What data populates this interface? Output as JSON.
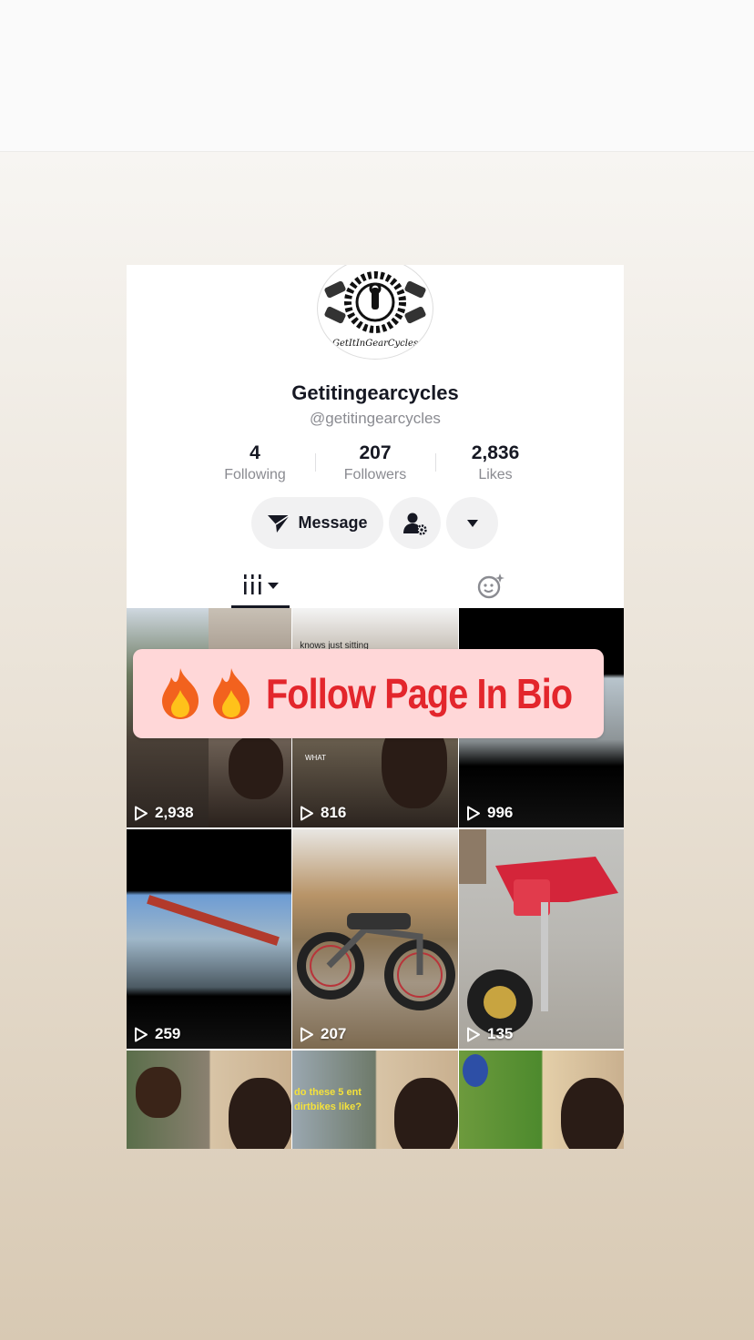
{
  "profile": {
    "display_name": "Getitingearcycles",
    "handle": "@getitingearcycles",
    "avatar_text": "GetItInGearCycles"
  },
  "stats": [
    {
      "value": "4",
      "label": "Following"
    },
    {
      "value": "207",
      "label": "Followers"
    },
    {
      "value": "2,836",
      "label": "Likes"
    }
  ],
  "actions": {
    "message_label": "Message",
    "add_friend_icon": "person-gear-icon",
    "more_icon": "caret-down-icon"
  },
  "tabs": [
    {
      "name": "videos",
      "icon": "grid-bars-icon",
      "active": true
    },
    {
      "name": "liked",
      "icon": "sparkle-face-icon",
      "active": false
    }
  ],
  "videos": [
    {
      "views": "2,938"
    },
    {
      "views": "816"
    },
    {
      "views": "996"
    },
    {
      "views": "259"
    },
    {
      "views": "207"
    },
    {
      "views": "135"
    },
    {
      "views": ""
    },
    {
      "views": ""
    },
    {
      "views": ""
    }
  ],
  "overlay_text": {
    "tile1_caption": "knows just sitting",
    "tile1_small": "WHAT",
    "tile7_caption": "do these 5 ent dirtbikes like?"
  },
  "banner": {
    "text": "Follow Page In Bio",
    "colors": {
      "background": "#ffd7d8",
      "text": "#e3262c"
    }
  }
}
